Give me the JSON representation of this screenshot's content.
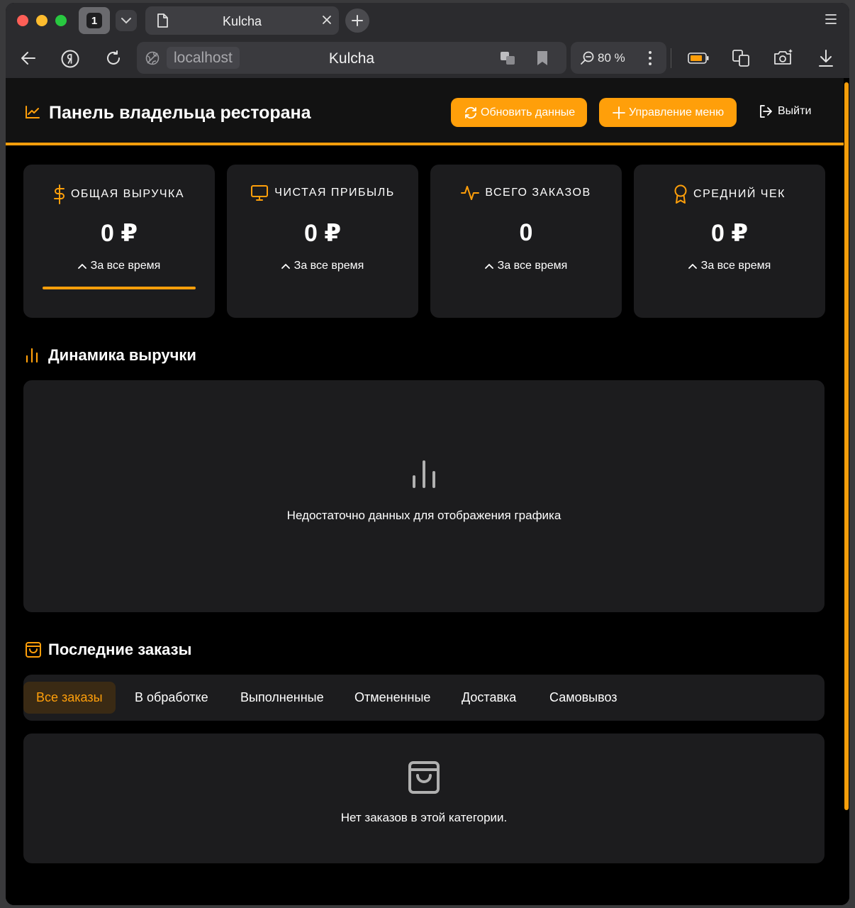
{
  "browser": {
    "tab_count": "1",
    "tab_title": "Kulcha",
    "url_host": "localhost",
    "url_title": "Kulcha",
    "zoom": "80 %"
  },
  "header": {
    "title": "Панель владельца ресторана",
    "refresh_label": "Обновить данные",
    "menu_label": "Управление меню",
    "logout_label": "Выйти"
  },
  "stats": [
    {
      "label": "ОБЩАЯ ВЫРУЧКА",
      "value": "0 ₽",
      "period": "За все время",
      "icon": "dollar-icon"
    },
    {
      "label": "ЧИСТАЯ ПРИБЫЛЬ",
      "value": "0 ₽",
      "period": "За все время",
      "icon": "monitor-icon"
    },
    {
      "label": "ВСЕГО ЗАКАЗОВ",
      "value": "0",
      "period": "За все время",
      "icon": "activity-icon"
    },
    {
      "label": "СРЕДНИЙ ЧЕК",
      "value": "0 ₽",
      "period": "За все время",
      "icon": "award-icon"
    }
  ],
  "revenue": {
    "title": "Динамика выручки",
    "empty_text": "Недостаточно данных для отображения графика"
  },
  "orders": {
    "title": "Последние заказы",
    "filters": [
      "Все заказы",
      "В обработке",
      "Выполненные",
      "Отмененные",
      "Доставка",
      "Самовывоз"
    ],
    "active_filter": "Все заказы",
    "empty_text": "Нет заказов в этой категории."
  },
  "colors": {
    "accent": "#ff9f0a",
    "card_bg": "#1c1c1e",
    "page_bg": "#000000"
  }
}
